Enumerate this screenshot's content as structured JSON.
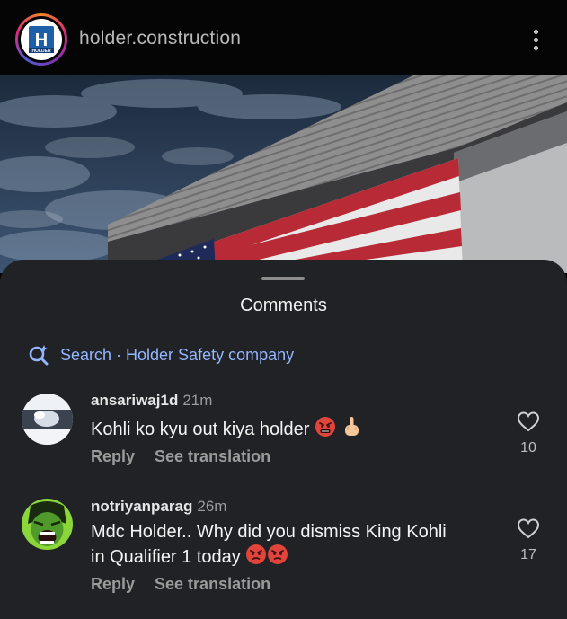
{
  "header": {
    "account_name": "holder.construction",
    "avatar_logo_text": "HOLDER",
    "avatar_logo_letter": "H",
    "more_icon": "more-vertical-icon"
  },
  "sheet": {
    "title": "Comments",
    "search_text": "Search · Holder Safety company",
    "search_icon": "ai-search-icon"
  },
  "comments": [
    {
      "username": "ansariwaj1d",
      "time": "21m",
      "text": "Kohli ko kyu out kiya holder",
      "emojis": [
        "angry-face-icon",
        "hand-gesture-icon"
      ],
      "reply": "Reply",
      "see_translation": "See translation",
      "likes": "10"
    },
    {
      "username": "notriyanparag",
      "time": "26m",
      "text_line1": "Mdc Holder.. Why did you dismiss King Kohli",
      "text_line2": "in Qualifier 1 today",
      "emojis": [
        "angry-face-icon",
        "angry-face-icon"
      ],
      "reply": "Reply",
      "see_translation": "See translation",
      "likes": "17"
    }
  ],
  "colors": {
    "sheet_bg": "#202226",
    "link_blue": "#93b6ff",
    "header_bg": "#050505"
  }
}
